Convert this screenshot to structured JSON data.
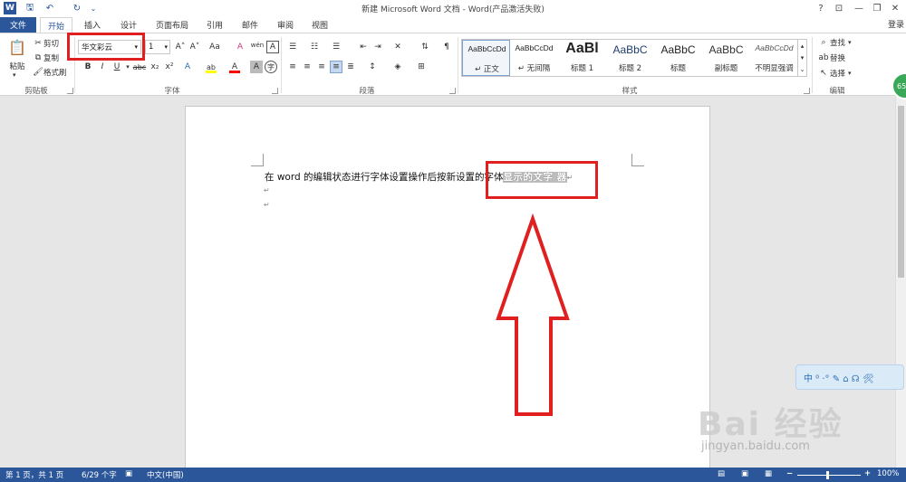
{
  "titlebar": {
    "title": "新建 Microsoft Word 文档 - Word(产品激活失败)",
    "help": "?",
    "min": "—",
    "restore": "❐",
    "close": "✕",
    "ribbon_opt": "⊡"
  },
  "tabs": {
    "file": "文件",
    "home": "开始",
    "insert": "插入",
    "design": "设计",
    "layout": "页面布局",
    "references": "引用",
    "mailings": "邮件",
    "review": "审阅",
    "view": "视图",
    "login": "登录"
  },
  "clipboard": {
    "paste": "粘贴",
    "cut": "剪切",
    "copy": "复制",
    "format_painter": "格式刷",
    "label": "剪贴板"
  },
  "font": {
    "name": "华文彩云",
    "size": "1",
    "grow": "A˄",
    "shrink": "A˅",
    "case": "Aa",
    "clear": "A",
    "phonetic": "wén",
    "charborder": "A",
    "bold": "B",
    "italic": "I",
    "underline": "U",
    "strike": "abc",
    "sub": "x₂",
    "sup": "x²",
    "effects": "A",
    "highlight": "ab",
    "color": "A",
    "shading": "A",
    "enclose": "字",
    "label": "字体",
    "color_value": "#ff0000",
    "highlight_value": "#ffff00"
  },
  "paragraph": {
    "label": "段落"
  },
  "styles": {
    "label": "样式",
    "items": [
      {
        "preview": "AaBbCcDd",
        "name": "↵ 正文"
      },
      {
        "preview": "AaBbCcDd",
        "name": "↵ 无间隔"
      },
      {
        "preview": "AaBl",
        "name": "标题 1"
      },
      {
        "preview": "AaBbC",
        "name": "标题 2"
      },
      {
        "preview": "AaBbC",
        "name": "标题"
      },
      {
        "preview": "AaBbC",
        "name": "副标题"
      },
      {
        "preview": "AaBbCcDd",
        "name": "不明显强调"
      }
    ]
  },
  "editing": {
    "find": "查找",
    "replace": "替换",
    "select": "选择",
    "label": "编辑"
  },
  "document": {
    "text_before": "在 word 的编辑状态进行字体设置操作后按新设置的字体",
    "selected_text": "显示的文字 器",
    "para_mark": "↵"
  },
  "statusbar": {
    "page": "第 1 页，共 1 页",
    "words": "6/29 个字",
    "lang": "中文(中国)",
    "zoom": "100%",
    "zoom_minus": "−",
    "zoom_plus": "+"
  },
  "overlay": {
    "watermark_main": "Bai 经验",
    "watermark_sub": "jingyan.baidu.com",
    "float_toolbar": "中 ⁰ ·° ✎ ⌂ ☊ 🛠",
    "badge": "65"
  },
  "colors": {
    "accent": "#2b579a",
    "annotation": "#e02020"
  }
}
